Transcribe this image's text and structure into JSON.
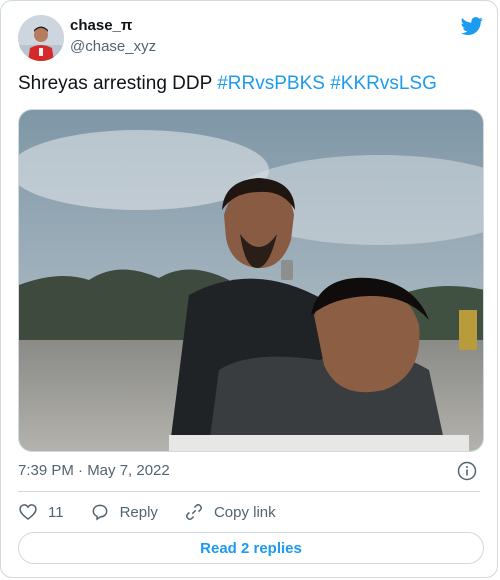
{
  "user": {
    "display_name": "chase_π",
    "handle": "@chase_xyz"
  },
  "tweet": {
    "text_plain": "Shreyas arresting DDP ",
    "hashtags": [
      "#RRvsPBKS",
      "#KKRvsLSG"
    ],
    "timestamp": "7:39 PM · May 7, 2022"
  },
  "actions": {
    "like_count": "11",
    "reply_label": "Reply",
    "copy_label": "Copy link"
  },
  "footer": {
    "read_replies_label": "Read 2 replies"
  },
  "colors": {
    "accent": "#1d9bf0",
    "muted_text": "#536471",
    "border": "#cfd9de"
  },
  "icons": [
    "twitter-bird-icon",
    "info-icon",
    "heart-icon",
    "reply-bubble-icon",
    "link-icon"
  ]
}
